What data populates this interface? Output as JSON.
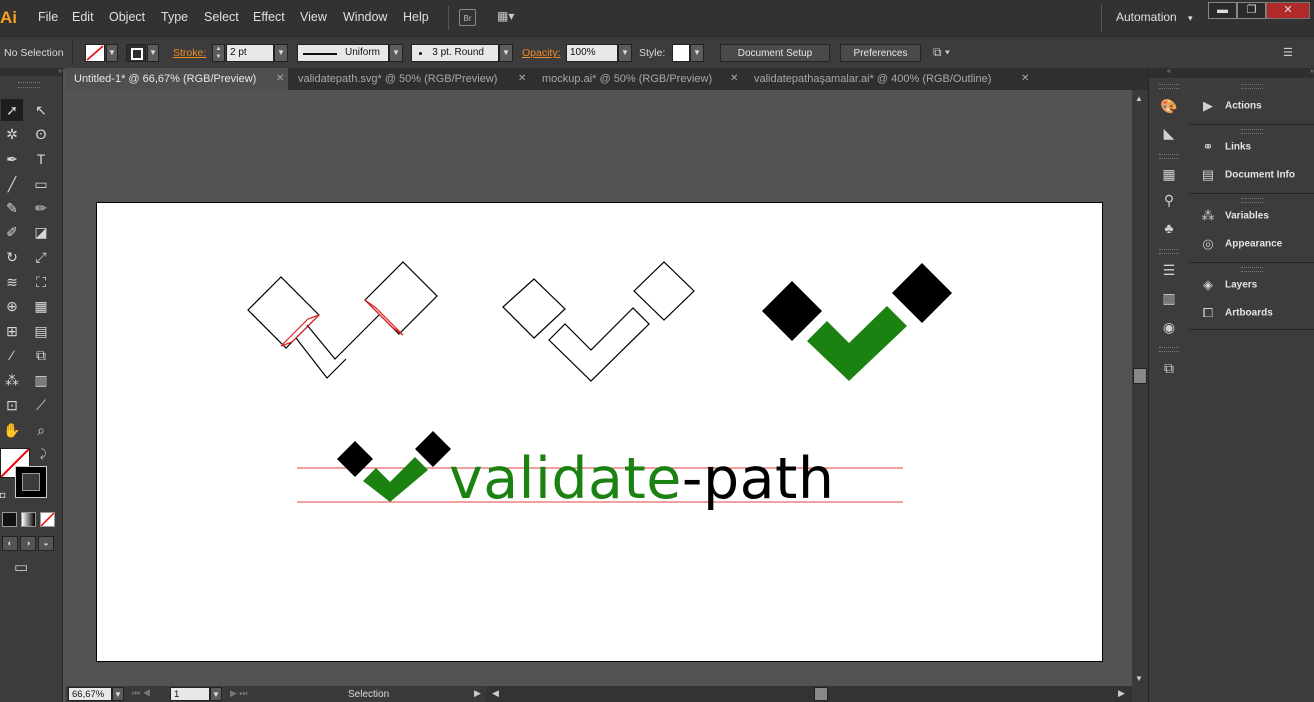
{
  "app": {
    "logo": "Ai",
    "menus": [
      "File",
      "Edit",
      "Object",
      "Type",
      "Select",
      "Effect",
      "View",
      "Window",
      "Help"
    ],
    "bridge_label": "Br",
    "workspace": "Automation",
    "window_controls": [
      "▬",
      "❐",
      "✕"
    ]
  },
  "control_bar": {
    "selection_state": "No Selection",
    "stroke_label": "Stroke:",
    "stroke_weight": "2 pt",
    "stroke_profile": "Uniform",
    "brush": "3 pt. Round",
    "opacity_label": "Opacity:",
    "opacity_value": "100%",
    "style_label": "Style:",
    "document_setup": "Document Setup",
    "preferences": "Preferences"
  },
  "tabs": [
    {
      "label": "Untitled-1* @ 66,67% (RGB/Preview)",
      "active": true
    },
    {
      "label": "validatepath.svg* @ 50% (RGB/Preview)",
      "active": false
    },
    {
      "label": "mockup.ai* @ 50% (RGB/Preview)",
      "active": false
    },
    {
      "label": "validatepathaşamalar.ai* @ 400% (RGB/Outline)",
      "active": false
    }
  ],
  "tab_close": "✕",
  "artwork": {
    "logo_word_green": "validate",
    "logo_word_black": "-path",
    "colors": {
      "green": "#1b8212",
      "black": "#000000",
      "guide_red": "#e03030"
    }
  },
  "status_bar": {
    "zoom": "66,67%",
    "artboard_number": "1",
    "status_text": "Selection"
  },
  "panels": [
    {
      "label": "Actions",
      "icon": "play-icon"
    },
    {
      "label": "Links",
      "icon": "link-icon"
    },
    {
      "label": "Document Info",
      "icon": "info-icon"
    },
    {
      "label": "Variables",
      "icon": "variables-icon"
    },
    {
      "label": "Appearance",
      "icon": "appearance-icon"
    },
    {
      "label": "Layers",
      "icon": "layers-icon"
    },
    {
      "label": "Artboards",
      "icon": "artboards-icon"
    }
  ]
}
